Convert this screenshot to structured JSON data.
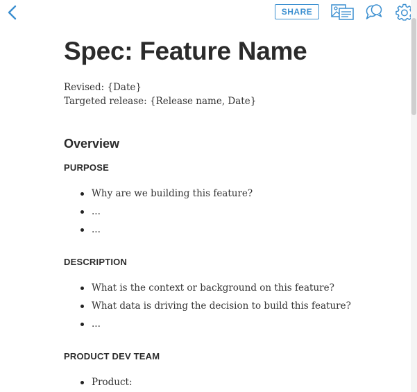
{
  "toolbar": {
    "back_icon": "chevron-left-icon",
    "share_label": "SHARE",
    "media_icon": "media-library-icon",
    "comments_icon": "comments-icon",
    "settings_icon": "gear-icon",
    "accent_color": "#3b8fd0"
  },
  "document": {
    "title": "Spec: Feature Name",
    "revised": "Revised: {Date}",
    "targeted_release": "Targeted release: {Release name, Date}",
    "overview_heading": "Overview",
    "sections": [
      {
        "heading": "PURPOSE",
        "items": [
          "Why are we building this feature?",
          "...",
          "..."
        ]
      },
      {
        "heading": "DESCRIPTION",
        "items": [
          "What is the context or background on this feature?",
          "What data is driving the decision to build this feature?",
          "..."
        ]
      },
      {
        "heading": "PRODUCT DEV TEAM",
        "items": [
          "Product:"
        ]
      }
    ]
  }
}
